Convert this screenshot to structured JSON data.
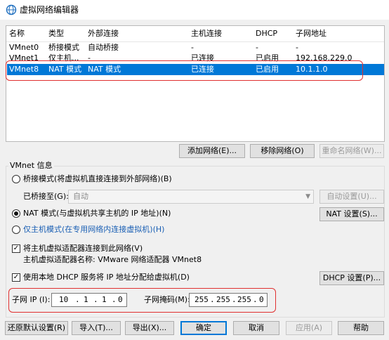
{
  "window": {
    "title": "虚拟网络编辑器",
    "icon": "vmware-network-icon"
  },
  "table": {
    "headers": [
      "名称",
      "类型",
      "外部连接",
      "主机连接",
      "DHCP",
      "子网地址"
    ],
    "rows": [
      [
        "VMnet0",
        "桥接模式",
        "自动桥接",
        "-",
        "-",
        "-"
      ],
      [
        "VMnet1",
        "仅主机...",
        "-",
        "已连接",
        "已启用",
        "192.168.229.0"
      ],
      [
        "VMnet8",
        "NAT 模式",
        "NAT 模式",
        "已连接",
        "已启用",
        "10.1.1.0"
      ]
    ],
    "selected_row": 2
  },
  "list_buttons": {
    "add": "添加网络(E)...",
    "remove": "移除网络(O)",
    "rename": "重命名网络(W)..."
  },
  "vmnet_info": {
    "group_label": "VMnet 信息",
    "bridged_label": "桥接模式(将虚拟机直接连接到外部网络)(B)",
    "bridged_to_label": "已桥接至(G):",
    "bridged_to_value": "自动",
    "auto_settings": "自动设置(U)...",
    "nat_label": "NAT 模式(与虚拟机共享主机的 IP 地址)(N)",
    "nat_settings": "NAT 设置(S)...",
    "hostonly_label": "仅主机模式(在专用网络内连接虚拟机)(H)",
    "selected_mode": "nat",
    "connect_adapter_label": "将主机虚拟适配器连接到此网络(V)",
    "connect_adapter_checked": true,
    "adapter_name_label": "主机虚拟适配器名称: VMware 网络适配器 VMnet8",
    "dhcp_label": "使用本地 DHCP 服务将 IP 地址分配给虚拟机(D)",
    "dhcp_checked": true,
    "dhcp_settings": "DHCP 设置(P)...",
    "subnet_ip_label": "子网 IP (I):",
    "subnet_ip": [
      "10",
      "1",
      "1",
      "0"
    ],
    "subnet_mask_label": "子网掩码(M):",
    "subnet_mask": [
      "255",
      "255",
      "255",
      "0"
    ]
  },
  "footer": {
    "restore": "还原默认设置(R)",
    "import": "导入(T)...",
    "export": "导出(X)...",
    "ok": "确定",
    "cancel": "取消",
    "apply": "应用(A)",
    "help": "帮助"
  }
}
